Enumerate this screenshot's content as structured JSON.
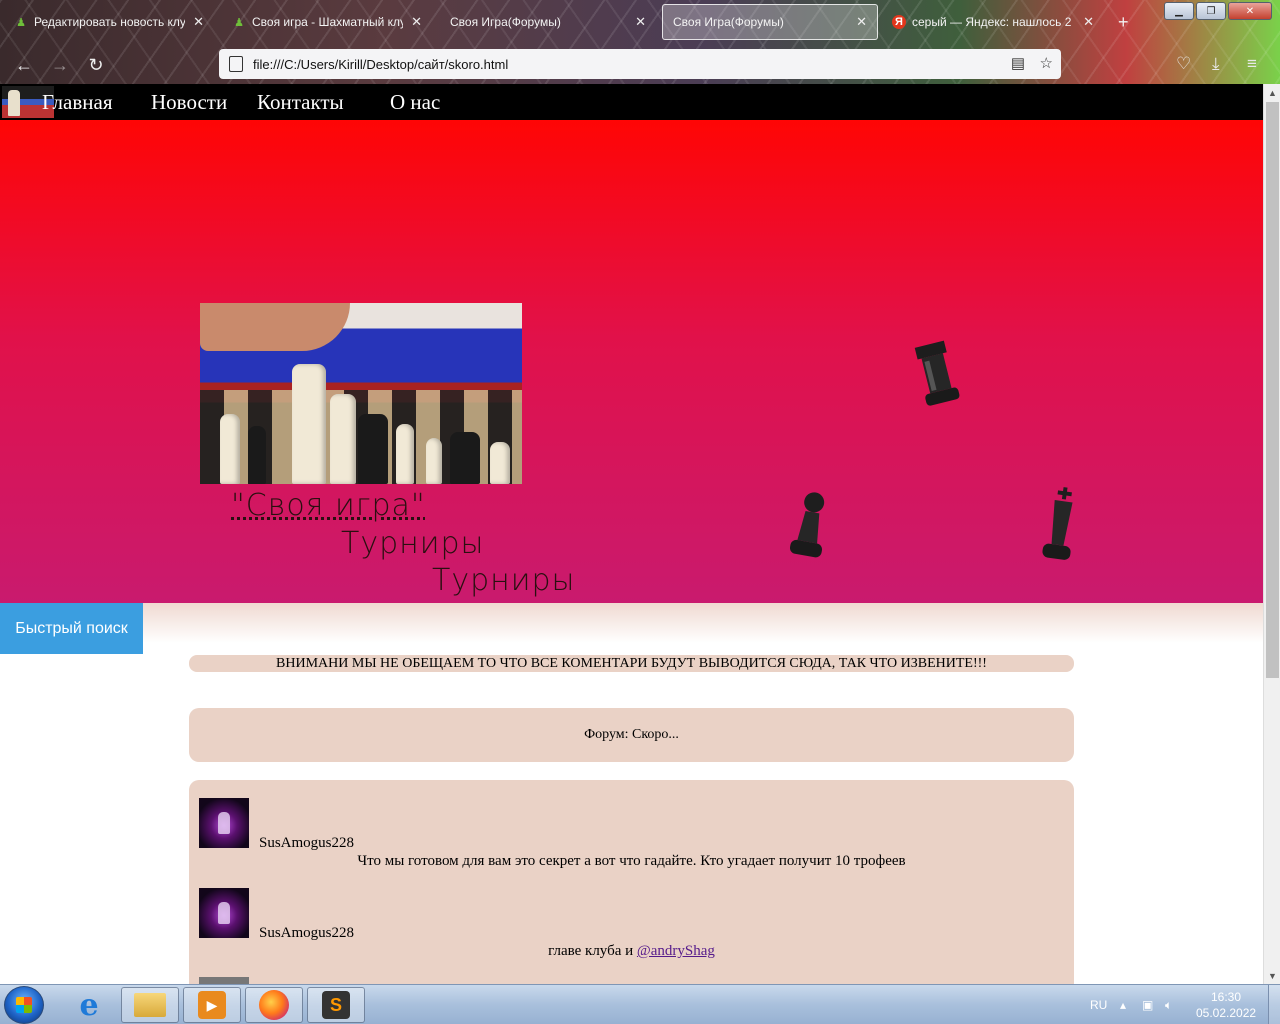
{
  "browser": {
    "tabs": [
      {
        "title": "Редактировать новость клуба",
        "favicon": "chess-pawn-green",
        "active": false
      },
      {
        "title": "Своя игра - Шахматный клуб",
        "favicon": "chess-pawn-green",
        "active": false
      },
      {
        "title": "Своя Игра(Форумы)",
        "favicon": "none",
        "active": false
      },
      {
        "title": "Своя Игра(Форумы)",
        "favicon": "none",
        "active": true
      },
      {
        "title": "серый — Яндекс: нашлось 2",
        "favicon": "yandex-logo",
        "active": false
      }
    ],
    "url": "file:///C:/Users/Kirill/Desktop/сайт/skoro.html",
    "tab_close_glyph": "✕",
    "new_tab_glyph": "+"
  },
  "site": {
    "nav": [
      "Главная",
      "Новости",
      "Контакты",
      "О нас"
    ],
    "hero": {
      "title_link": "\"Своя игра\"",
      "line2": "Турниры",
      "line3": "Турниры"
    },
    "quick_search": "Быстрый поиск",
    "notice": "ВНИМАНИ МЫ НЕ ОБЕЩАЕМ ТО ЧТО ВСЕ КОМЕНТАРИ БУДУТ ВЫВОДИТСЯ СЮДА, ТАК ЧТО ИЗВЕНИТЕ!!!",
    "forum_status": "Форум: Скоро...",
    "comments": [
      {
        "user": "SusAmogus228",
        "text": "Что мы готовом для вам это секрет а вот что гадайте. Кто угадает получит 10 трофеев",
        "mention": ""
      },
      {
        "user": "SusAmogus228",
        "text": "главе клуба и ",
        "mention": "@andryShag"
      }
    ]
  },
  "taskbar": {
    "language": "RU",
    "time": "16:30",
    "date": "05.02.2022",
    "apps": [
      "windows-start",
      "internet-explorer",
      "file-explorer",
      "media-player",
      "firefox",
      "sublime-text"
    ]
  },
  "colors": {
    "hero_top": "#ff0505",
    "hero_bottom": "#c91a6e",
    "panel": "#ead2c6",
    "quick_search": "#3b9ee0"
  }
}
